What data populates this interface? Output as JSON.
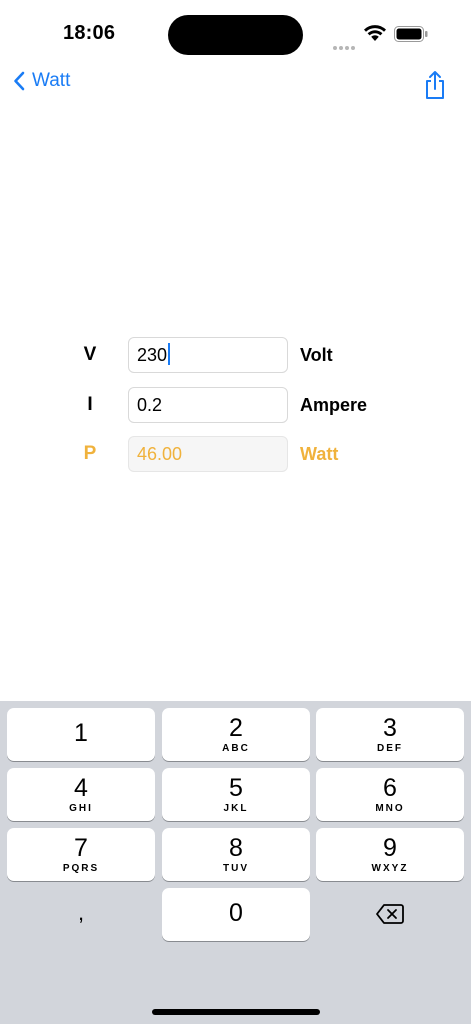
{
  "status": {
    "time": "18:06"
  },
  "nav": {
    "back_label": "Watt"
  },
  "form": {
    "voltage": {
      "symbol": "V",
      "value": "230",
      "unit": "Volt"
    },
    "current": {
      "symbol": "I",
      "value": "0.2",
      "unit": "Ampere"
    },
    "power": {
      "symbol": "P",
      "value": "46.00",
      "unit": "Watt"
    }
  },
  "keyboard": {
    "keys": [
      {
        "num": "1",
        "letters": ""
      },
      {
        "num": "2",
        "letters": "ABC"
      },
      {
        "num": "3",
        "letters": "DEF"
      },
      {
        "num": "4",
        "letters": "GHI"
      },
      {
        "num": "5",
        "letters": "JKL"
      },
      {
        "num": "6",
        "letters": "MNO"
      },
      {
        "num": "7",
        "letters": "PQRS"
      },
      {
        "num": "8",
        "letters": "TUV"
      },
      {
        "num": "9",
        "letters": "WXYZ"
      },
      {
        "num": "0",
        "letters": ""
      }
    ],
    "decimal_label": ","
  },
  "colors": {
    "accent": "#1a7cf5",
    "result": "#f0b23c",
    "keyboard_bg": "#d2d5db"
  }
}
